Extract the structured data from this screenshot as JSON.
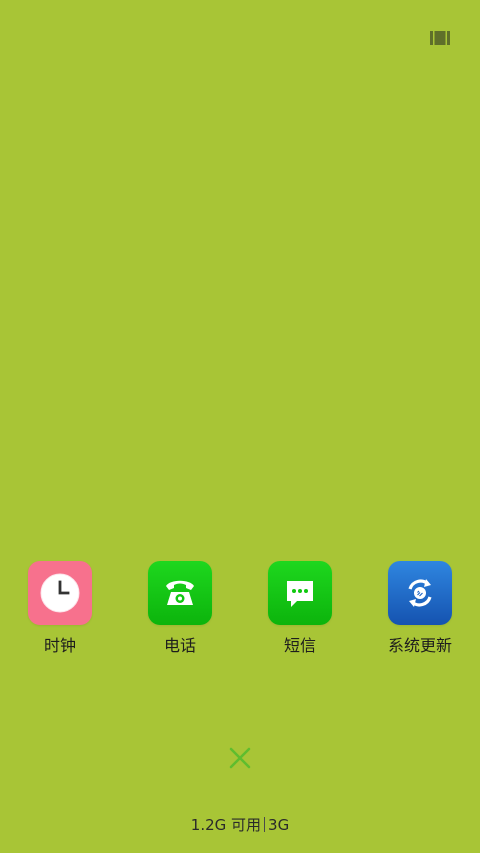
{
  "topbar": {
    "icon": "panel-toggle-icon"
  },
  "apps": [
    {
      "label": "时钟",
      "icon": "clock-icon",
      "color": "#f7718d"
    },
    {
      "label": "电话",
      "icon": "phone-icon",
      "color": "#10c810"
    },
    {
      "label": "短信",
      "icon": "message-icon",
      "color": "#10c810"
    },
    {
      "label": "系统更新",
      "icon": "system-update-icon",
      "color": "#1f66c6"
    }
  ],
  "close": {
    "icon": "close-icon",
    "color": "#5fbd2e"
  },
  "memory": {
    "available": "1.2G 可用",
    "network": "3G"
  }
}
